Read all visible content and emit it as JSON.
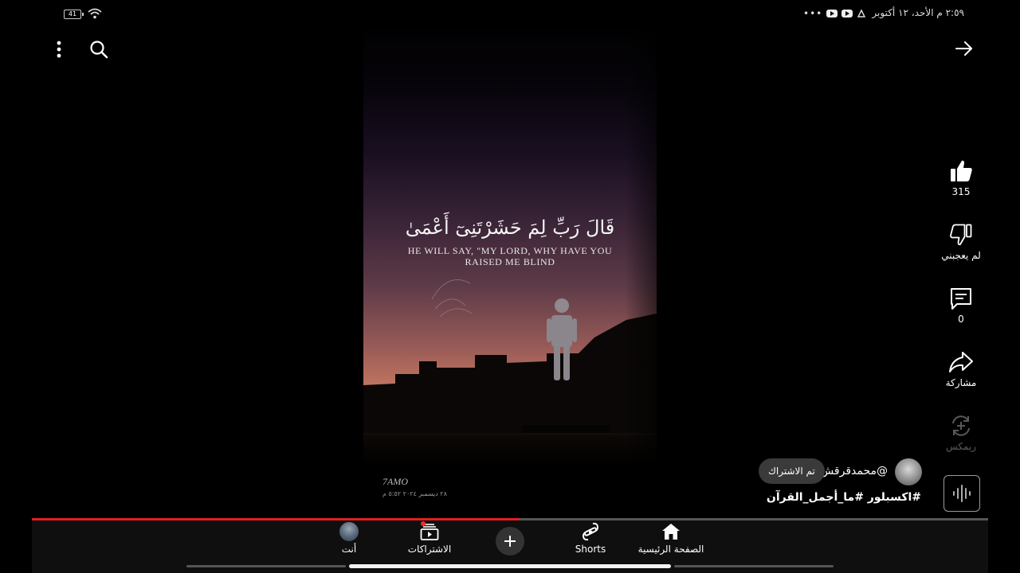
{
  "status_bar": {
    "battery": "41",
    "time_date": "٢:٥٩ م الأحد، ١٢ أكتوبر",
    "icons": [
      "wifi-icon",
      "youtube-icon",
      "youtube-icon",
      "notification-icon",
      "more-dots-icon"
    ]
  },
  "top_bar": {
    "icons": [
      "back-arrow-icon",
      "search-icon",
      "more-vertical-icon"
    ]
  },
  "video": {
    "arabic_text": "قَالَ رَبِّ لِمَ حَشَرْتَنِىٓ أَعْمَىٰ",
    "english_line1": "HE WILL SAY, \"MY LORD, WHY HAVE YOU",
    "english_line2": "RAISED ME BLIND",
    "watermark_name": "7AMO",
    "watermark_date": "٢٨ ديسمبر ٢٠٢٤ ٥:٥٢ م"
  },
  "actions": {
    "like_count": "315",
    "dislike_label": "لم يعجبني",
    "comments_count": "0",
    "share_label": "مشاركة",
    "remix_label": "ريمكس",
    "icons": [
      "thumbs-up-icon",
      "thumbs-down-icon",
      "comment-icon",
      "share-icon",
      "remix-icon",
      "sound-wave-icon"
    ]
  },
  "channel": {
    "handle": "@محمدقرقش",
    "subscribe_label": "تم الاشتراك"
  },
  "title": "#اكسبلور #ما_أجمل_القرآن",
  "progress": {
    "fraction": 0.51
  },
  "bottom_nav": {
    "home": "الصفحة الرئيسية",
    "shorts": "Shorts",
    "subscriptions": "الاشتراكات",
    "you": "أنت",
    "icons": [
      "home-icon",
      "shorts-icon",
      "plus-icon",
      "subscriptions-icon",
      "avatar"
    ]
  },
  "colors": {
    "background": "#000000",
    "progress": "#e02020",
    "nav_background": "#0f0f0f",
    "notification_dot": "#ff2a2a"
  }
}
